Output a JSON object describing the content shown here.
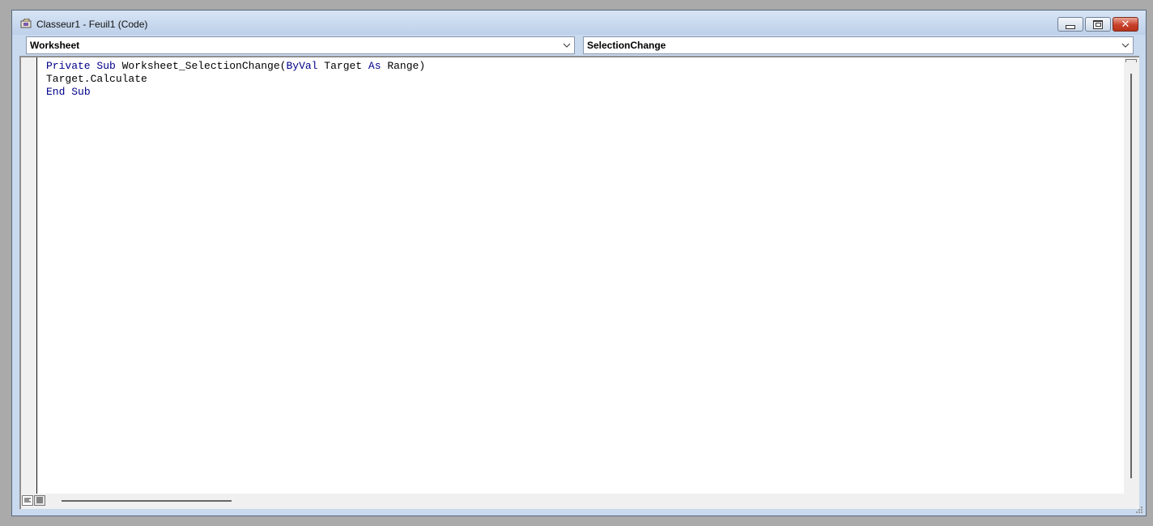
{
  "window": {
    "title": "Classeur1 - Feuil1 (Code)"
  },
  "icons": {
    "app": "vba-module-icon",
    "minimize": "minimize-icon",
    "maximize": "restore-icon",
    "close": "close-icon",
    "dropdown": "chevron-down-icon",
    "procedure_view": "procedure-view-icon",
    "full_module_view": "full-module-view-icon",
    "resize_grip": "resize-grip-icon"
  },
  "object_combo": {
    "value": "Worksheet"
  },
  "procedure_combo": {
    "value": "SelectionChange"
  },
  "code": {
    "lines": [
      [
        {
          "text": "Private",
          "kw": true
        },
        {
          "text": " ",
          "kw": false
        },
        {
          "text": "Sub",
          "kw": true
        },
        {
          "text": " Worksheet_SelectionChange(",
          "kw": false
        },
        {
          "text": "ByVal",
          "kw": true
        },
        {
          "text": " Target ",
          "kw": false
        },
        {
          "text": "As",
          "kw": true
        },
        {
          "text": " Range)",
          "kw": false
        }
      ],
      [
        {
          "text": "Target.Calculate",
          "kw": false
        }
      ],
      [
        {
          "text": "End",
          "kw": true
        },
        {
          "text": " ",
          "kw": false
        },
        {
          "text": "Sub",
          "kw": true
        }
      ]
    ]
  },
  "colors": {
    "keyword": "#00008b",
    "text": "#000000",
    "titlebar": "#c9d9ee"
  }
}
